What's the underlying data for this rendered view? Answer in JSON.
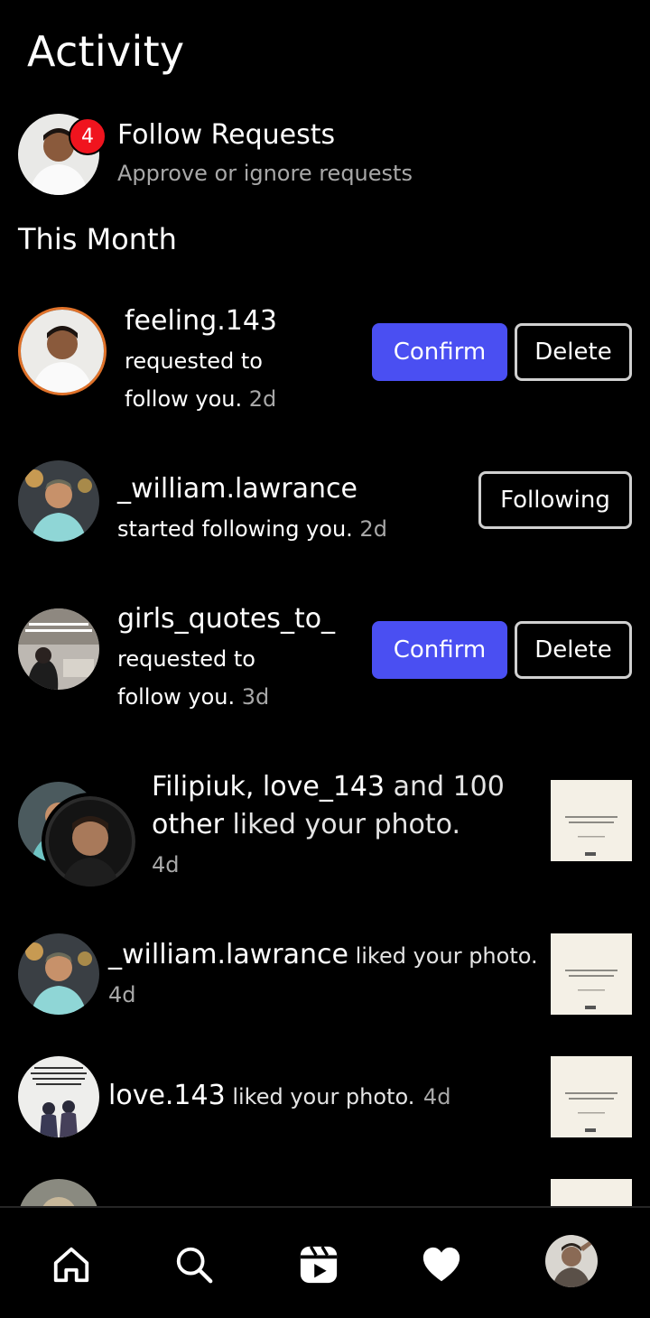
{
  "header": {
    "title": "Activity"
  },
  "follow_requests": {
    "badge_count": "4",
    "title": "Follow Requests",
    "subtitle": "Approve or ignore requests"
  },
  "section_title": "This Month",
  "items": [
    {
      "username": "feeling.143",
      "line1": "requested to",
      "line2": "follow you.",
      "time": "2d",
      "confirm_label": "Confirm",
      "delete_label": "Delete"
    },
    {
      "username": "_william.lawrance",
      "line1": "started following you.",
      "time": "2d",
      "following_label": "Following"
    },
    {
      "username": "girls_quotes_to_",
      "line1": "requested to",
      "line2": "follow you.",
      "time": "3d",
      "confirm_label": "Confirm",
      "delete_label": "Delete"
    },
    {
      "line1_users": "Filipiuk, love_143",
      "line1_rest": " and 100",
      "line2_a": "other",
      "line2_b": " liked your photo.",
      "time": "4d"
    },
    {
      "username": "_william.lawrance",
      "action": " liked your photo.",
      "time": "4d"
    },
    {
      "username": "love.143",
      "action": " liked your photo.",
      "time": "4d"
    }
  ],
  "bottom_nav": [
    {
      "icon": "home-icon"
    },
    {
      "icon": "search-icon"
    },
    {
      "icon": "reels-icon"
    },
    {
      "icon": "heart-icon"
    },
    {
      "icon": "profile-avatar"
    }
  ],
  "colors": {
    "background": "#000000",
    "confirm": "#4a4ff2",
    "badge": "#f0141e",
    "muted_text": "#a8a8a8",
    "story_ring": "#e0722a"
  }
}
